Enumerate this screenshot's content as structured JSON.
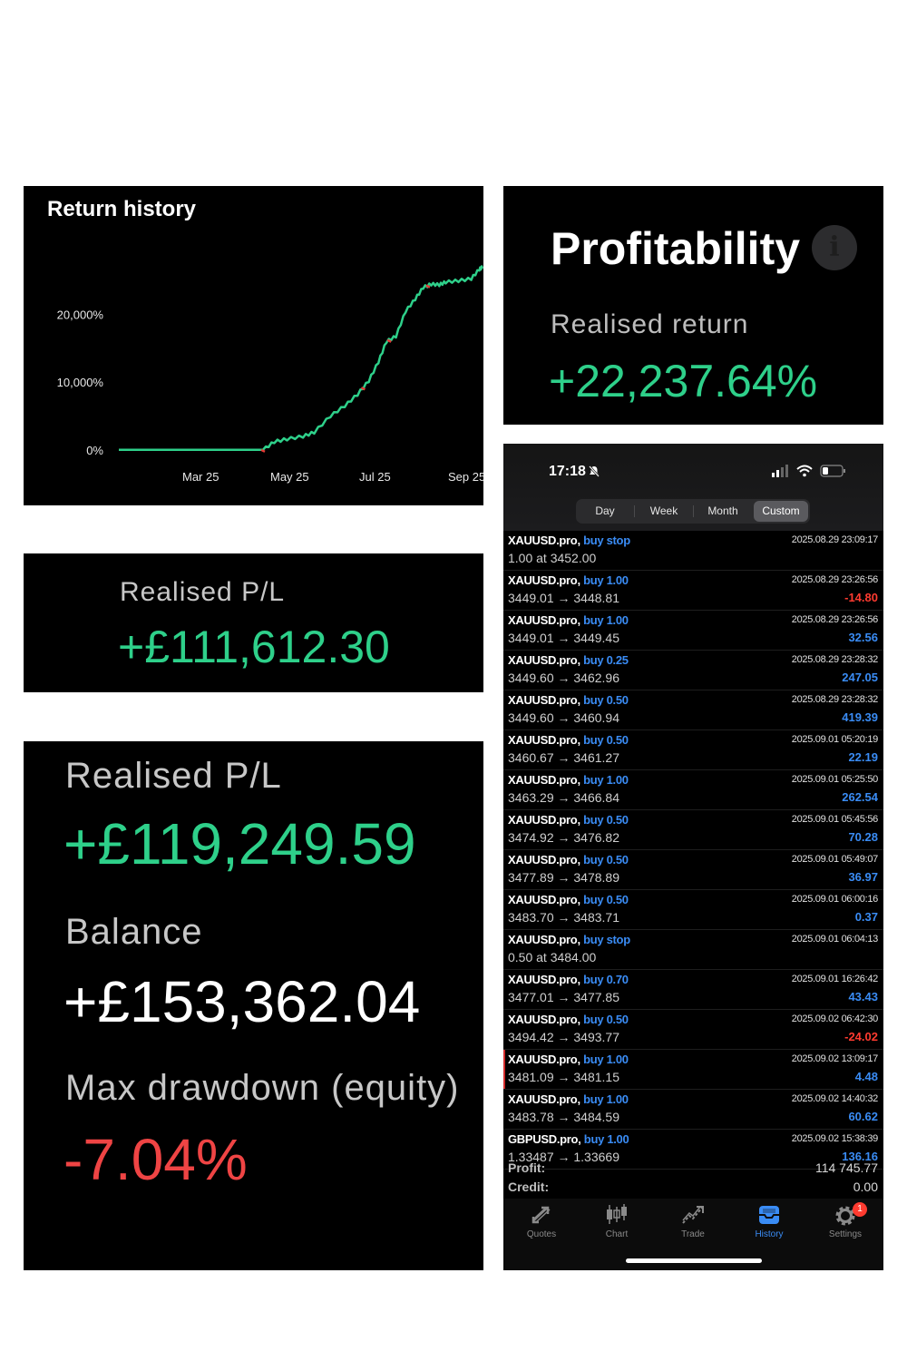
{
  "return_history": {
    "title": "Return history",
    "chart_data": {
      "type": "line",
      "title": "Return history",
      "y_ticks": [
        "20,000%",
        "10,000%",
        "0%"
      ],
      "x_ticks": [
        "Mar 25",
        "May 25",
        "Jul 25",
        "Sep 25"
      ],
      "ylim": [
        -1500,
        28000
      ],
      "grid": false,
      "series": [
        {
          "color": "#2ed08a",
          "x": [
            "2025-01-20",
            "2025-02-15",
            "2025-03-10",
            "2025-04-01",
            "2025-04-20",
            "2025-04-27",
            "2025-05-05",
            "2025-05-15",
            "2025-05-22",
            "2025-06-01",
            "2025-06-10",
            "2025-06-18",
            "2025-06-25",
            "2025-07-01",
            "2025-07-06",
            "2025-07-12",
            "2025-07-18",
            "2025-07-24",
            "2025-07-29",
            "2025-08-03",
            "2025-08-08",
            "2025-08-12",
            "2025-08-20",
            "2025-08-28",
            "2025-09-02",
            "2025-09-04"
          ],
          "values": [
            0,
            0,
            0,
            0,
            0,
            1200,
            1600,
            2000,
            2600,
            5000,
            6500,
            8200,
            10200,
            13000,
            16000,
            16800,
            20500,
            22300,
            24000,
            24500,
            24400,
            24800,
            25000,
            25300,
            26700,
            27000
          ]
        }
      ]
    }
  },
  "profitability": {
    "title": "Profitability",
    "info_icon": "info-icon",
    "realised_return_label": "Realised return",
    "realised_return_value": "+22,237.64%"
  },
  "realised_pl_small": {
    "label": "Realised P/L",
    "value": "+£111,612.30"
  },
  "stats": {
    "realised_pl_label": "Realised P/L",
    "realised_pl_value": "+£119,249.59",
    "balance_label": "Balance",
    "balance_value": "+£153,362.04",
    "drawdown_label": "Max drawdown (equity)",
    "drawdown_value": "-7.04%",
    "colors": {
      "positive": "#2ed08a",
      "neutral": "#ffffff",
      "negative": "#ef4444"
    }
  },
  "phone": {
    "time": "17:18",
    "segments": [
      "Day",
      "Week",
      "Month",
      "Custom"
    ],
    "active_segment": "Custom",
    "trades": [
      {
        "symbol": "XAUUSD.pro,",
        "action": "buy stop",
        "prices": "1.00 at 3452.00",
        "date": "2025.08.29 23:09:17",
        "amount": "",
        "sign": "pos"
      },
      {
        "symbol": "XAUUSD.pro,",
        "action": "buy 1.00",
        "prices": "3449.01 → 3448.81",
        "date": "2025.08.29 23:26:56",
        "amount": "-14.80",
        "sign": "neg"
      },
      {
        "symbol": "XAUUSD.pro,",
        "action": "buy 1.00",
        "prices": "3449.01 → 3449.45",
        "date": "2025.08.29 23:26:56",
        "amount": "32.56",
        "sign": "pos"
      },
      {
        "symbol": "XAUUSD.pro,",
        "action": "buy 0.25",
        "prices": "3449.60 → 3462.96",
        "date": "2025.08.29 23:28:32",
        "amount": "247.05",
        "sign": "pos"
      },
      {
        "symbol": "XAUUSD.pro,",
        "action": "buy 0.50",
        "prices": "3449.60 → 3460.94",
        "date": "2025.08.29 23:28:32",
        "amount": "419.39",
        "sign": "pos"
      },
      {
        "symbol": "XAUUSD.pro,",
        "action": "buy 0.50",
        "prices": "3460.67 → 3461.27",
        "date": "2025.09.01 05:20:19",
        "amount": "22.19",
        "sign": "pos"
      },
      {
        "symbol": "XAUUSD.pro,",
        "action": "buy 1.00",
        "prices": "3463.29 → 3466.84",
        "date": "2025.09.01 05:25:50",
        "amount": "262.54",
        "sign": "pos"
      },
      {
        "symbol": "XAUUSD.pro,",
        "action": "buy 0.50",
        "prices": "3474.92 → 3476.82",
        "date": "2025.09.01 05:45:56",
        "amount": "70.28",
        "sign": "pos"
      },
      {
        "symbol": "XAUUSD.pro,",
        "action": "buy 0.50",
        "prices": "3477.89 → 3478.89",
        "date": "2025.09.01 05:49:07",
        "amount": "36.97",
        "sign": "pos"
      },
      {
        "symbol": "XAUUSD.pro,",
        "action": "buy 0.50",
        "prices": "3483.70 → 3483.71",
        "date": "2025.09.01 06:00:16",
        "amount": "0.37",
        "sign": "pos"
      },
      {
        "symbol": "XAUUSD.pro,",
        "action": "buy stop",
        "prices": "0.50 at 3484.00",
        "date": "2025.09.01 06:04:13",
        "amount": "",
        "sign": "pos"
      },
      {
        "symbol": "XAUUSD.pro,",
        "action": "buy 0.70",
        "prices": "3477.01 → 3477.85",
        "date": "2025.09.01 16:26:42",
        "amount": "43.43",
        "sign": "pos"
      },
      {
        "symbol": "XAUUSD.pro,",
        "action": "buy 0.50",
        "prices": "3494.42 → 3493.77",
        "date": "2025.09.02 06:42:30",
        "amount": "-24.02",
        "sign": "neg"
      },
      {
        "symbol": "XAUUSD.pro,",
        "action": "buy 1.00",
        "prices": "3481.09 → 3481.15",
        "date": "2025.09.02 13:09:17",
        "amount": "4.48",
        "sign": "pos",
        "marked": true
      },
      {
        "symbol": "XAUUSD.pro,",
        "action": "buy 1.00",
        "prices": "3483.78 → 3484.59",
        "date": "2025.09.02 14:40:32",
        "amount": "60.62",
        "sign": "pos"
      },
      {
        "symbol": "GBPUSD.pro,",
        "action": "buy 1.00",
        "prices": "1.33487 → 1.33669",
        "date": "2025.09.02 15:38:39",
        "amount": "136.16",
        "sign": "pos"
      }
    ],
    "profit_label": "Profit:",
    "profit_value": "114 745.77",
    "credit_label": "Credit:",
    "credit_value": "0.00",
    "tabs": [
      {
        "label": "Quotes",
        "icon": "quotes-icon"
      },
      {
        "label": "Chart",
        "icon": "candlestick-chart-icon"
      },
      {
        "label": "Trade",
        "icon": "trade-icon"
      },
      {
        "label": "History",
        "icon": "history-inbox-icon"
      },
      {
        "label": "Settings",
        "icon": "gear-icon"
      }
    ],
    "active_tab": "History",
    "settings_badge": "1"
  }
}
